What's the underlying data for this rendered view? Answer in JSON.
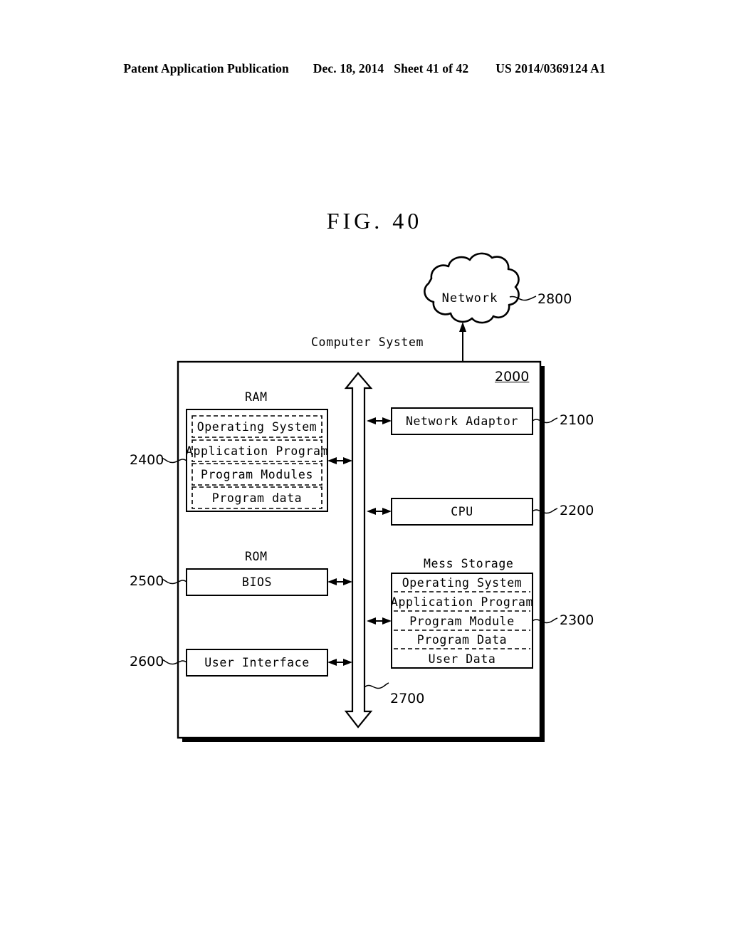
{
  "header": {
    "publication": "Patent Application Publication",
    "date": "Dec. 18, 2014",
    "sheet": "Sheet 41 of 42",
    "patent_number": "US 2014/0369124 A1"
  },
  "figure": {
    "title": "FIG.  40"
  },
  "diagram": {
    "network_cloud": {
      "label": "Network",
      "ref": "2800"
    },
    "computer_system": {
      "caption": "Computer System",
      "ref": "2000"
    },
    "bus": {
      "ref": "2700"
    },
    "ram": {
      "caption": "RAM",
      "ref": "2400",
      "items": [
        "Operating System",
        "Application Program",
        "Program Modules",
        "Program data"
      ]
    },
    "rom": {
      "caption": "ROM",
      "ref": "2500",
      "label": "BIOS"
    },
    "user_interface": {
      "ref": "2600",
      "label": "User Interface"
    },
    "network_adaptor": {
      "ref": "2100",
      "label": "Network Adaptor"
    },
    "cpu": {
      "ref": "2200",
      "label": "CPU"
    },
    "mass_storage": {
      "caption": "Mess Storage",
      "ref": "2300",
      "items": [
        "Operating System",
        "Application Program",
        "Program Module",
        "Program Data",
        "User Data"
      ]
    }
  }
}
